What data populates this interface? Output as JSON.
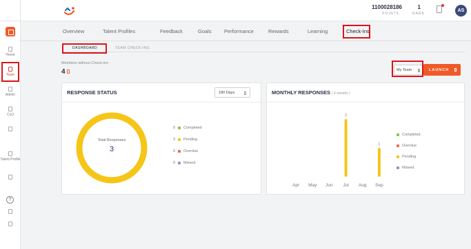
{
  "topbar": {
    "points_value": "1100028186",
    "points_label": "POINTS",
    "rank_value": "1",
    "rank_label": "RANK",
    "avatar_initials": "AS",
    "notification_icon": "bell-icon",
    "logo_icon": "brand-logo-icon"
  },
  "rail": {
    "items": [
      {
        "label": "Home",
        "icon": "home-icon"
      },
      {
        "label": "Team",
        "icon": "team-icon"
      },
      {
        "label": "Admin",
        "icon": "admin-icon"
      },
      {
        "label": "CxO",
        "icon": "cxo-icon"
      },
      {
        "label": "",
        "icon": "grid-icon"
      },
      {
        "label": "Talent Profile",
        "icon": "talent-profile-icon"
      },
      {
        "label": "",
        "icon": "document-icon"
      },
      {
        "label": "",
        "icon": "help-icon"
      },
      {
        "label": "",
        "icon": "settings-icon"
      },
      {
        "label": "",
        "icon": "logout-icon"
      }
    ]
  },
  "nav": {
    "tabs": [
      "Overview",
      "Talent Profiles",
      "Feedback",
      "Goals",
      "Performance",
      "Rewards",
      "Learning",
      "Check-Ins"
    ],
    "active": "Check-Ins"
  },
  "subtabs": {
    "items": [
      "DASHBOARD",
      "TEAM CHECK-INS"
    ],
    "active": "DASHBOARD"
  },
  "members": {
    "label": "Members without Check-ins",
    "value": "4"
  },
  "controls": {
    "team_select": "My Team",
    "launch_label": "LAUNCH"
  },
  "response_status": {
    "title": "RESPONSE STATUS",
    "period": "180 Days",
    "total_label": "Total Responses",
    "total_value": "3",
    "legend": [
      {
        "count": "0",
        "label": "Completed",
        "color": "#8bc34a"
      },
      {
        "count": "3",
        "label": "Pending",
        "color": "#f5c518"
      },
      {
        "count": "0",
        "label": "Overdue",
        "color": "#f2694f"
      },
      {
        "count": "0",
        "label": "Missed",
        "color": "#8a9bb5"
      }
    ],
    "donut_color": "#f5c518"
  },
  "monthly_responses": {
    "title": "MONTHLY RESPONSES",
    "subtitle": "( 6 months )",
    "legend": [
      {
        "label": "Completed",
        "color": "#8bc34a"
      },
      {
        "label": "Overdue",
        "color": "#f2694f"
      },
      {
        "label": "Pending",
        "color": "#f5c518"
      },
      {
        "label": "Missed",
        "color": "#8a9bb5"
      }
    ]
  },
  "chart_data": {
    "type": "bar",
    "categories": [
      "Apr",
      "May",
      "Jun",
      "Jul",
      "Aug",
      "Sep"
    ],
    "series": [
      {
        "name": "Pending",
        "values": [
          0,
          0,
          0,
          2,
          0,
          1
        ]
      }
    ],
    "ylim": [
      0,
      2
    ],
    "grid": false,
    "legend_placement": "right"
  }
}
